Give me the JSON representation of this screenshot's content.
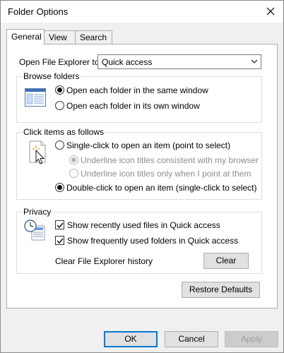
{
  "window": {
    "title": "Folder Options"
  },
  "tabs": [
    {
      "label": "General"
    },
    {
      "label": "View"
    },
    {
      "label": "Search"
    }
  ],
  "open_to": {
    "label": "Open File Explorer to:",
    "selected": "Quick access"
  },
  "browse": {
    "label": "Browse folders",
    "options": [
      {
        "label": "Open each folder in the same window",
        "checked": true
      },
      {
        "label": "Open each folder in its own window",
        "checked": false
      }
    ]
  },
  "click": {
    "label": "Click items as follows",
    "single": "Single-click to open an item (point to select)",
    "underline_browser": "Underline icon titles consistent with my browser",
    "underline_point": "Underline icon titles only when I point at them",
    "double": "Double-click to open an item (single-click to select)"
  },
  "privacy": {
    "label": "Privacy",
    "recent_files": "Show recently used files in Quick access",
    "frequent_folders": "Show frequently used folders in Quick access",
    "clear_history_label": "Clear File Explorer history",
    "clear_button": "Clear"
  },
  "restore_button": "Restore Defaults",
  "footer": {
    "ok": "OK",
    "cancel": "Cancel",
    "apply": "Apply"
  }
}
